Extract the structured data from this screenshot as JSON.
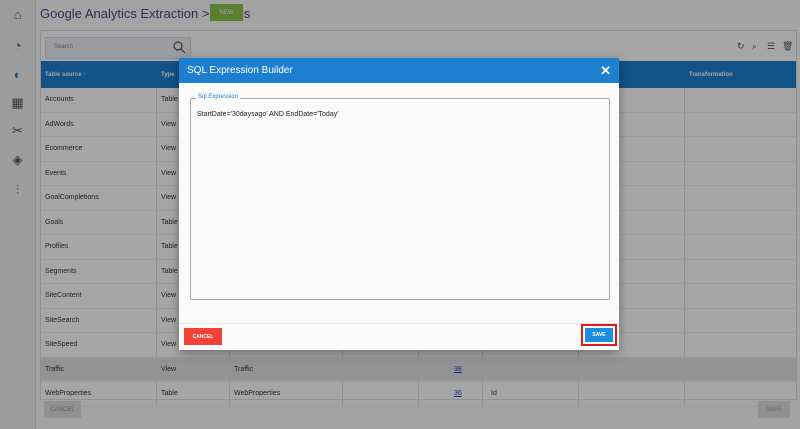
{
  "header": {
    "title": "Google Analytics Extraction > Tables",
    "new_label": "NEW"
  },
  "search": {
    "placeholder": "Search"
  },
  "table": {
    "columns": [
      "Table source",
      "Type",
      "",
      "",
      "",
      "",
      "",
      "Transformation"
    ],
    "sort_indicator": "↑",
    "rows": [
      {
        "source": "Accounts",
        "type": "Table"
      },
      {
        "source": "AdWords",
        "type": "View"
      },
      {
        "source": "Ecommerce",
        "type": "View"
      },
      {
        "source": "Events",
        "type": "View"
      },
      {
        "source": "GoalCompletions",
        "type": "View"
      },
      {
        "source": "Goals",
        "type": "Table"
      },
      {
        "source": "Profiles",
        "type": "Table"
      },
      {
        "source": "Segments",
        "type": "Table"
      },
      {
        "source": "SiteContent",
        "type": "View"
      },
      {
        "source": "SiteSearch",
        "type": "View"
      },
      {
        "source": "SiteSpeed",
        "type": "View"
      },
      {
        "source": "Traffic",
        "type": "View",
        "target": "Traffic",
        "count": "38",
        "key": ""
      },
      {
        "source": "WebProperties",
        "type": "Table",
        "target": "WebProperties",
        "count": "36",
        "key": "Id"
      }
    ]
  },
  "footer": {
    "cancel_label": "CANCEL",
    "save_label": "SAVE"
  },
  "modal": {
    "title": "SQL Expression Builder",
    "close_glyph": "✕",
    "field_label": "Sql Expression",
    "expression": "StartDate='30daysago' AND EndDate='Today'",
    "cancel_label": "CANCEL",
    "save_label": "SAVE"
  },
  "colors": {
    "accent": "#1c7fd0",
    "danger": "#f44336",
    "highlight": "#e01b1b",
    "new": "#8bc34a"
  }
}
